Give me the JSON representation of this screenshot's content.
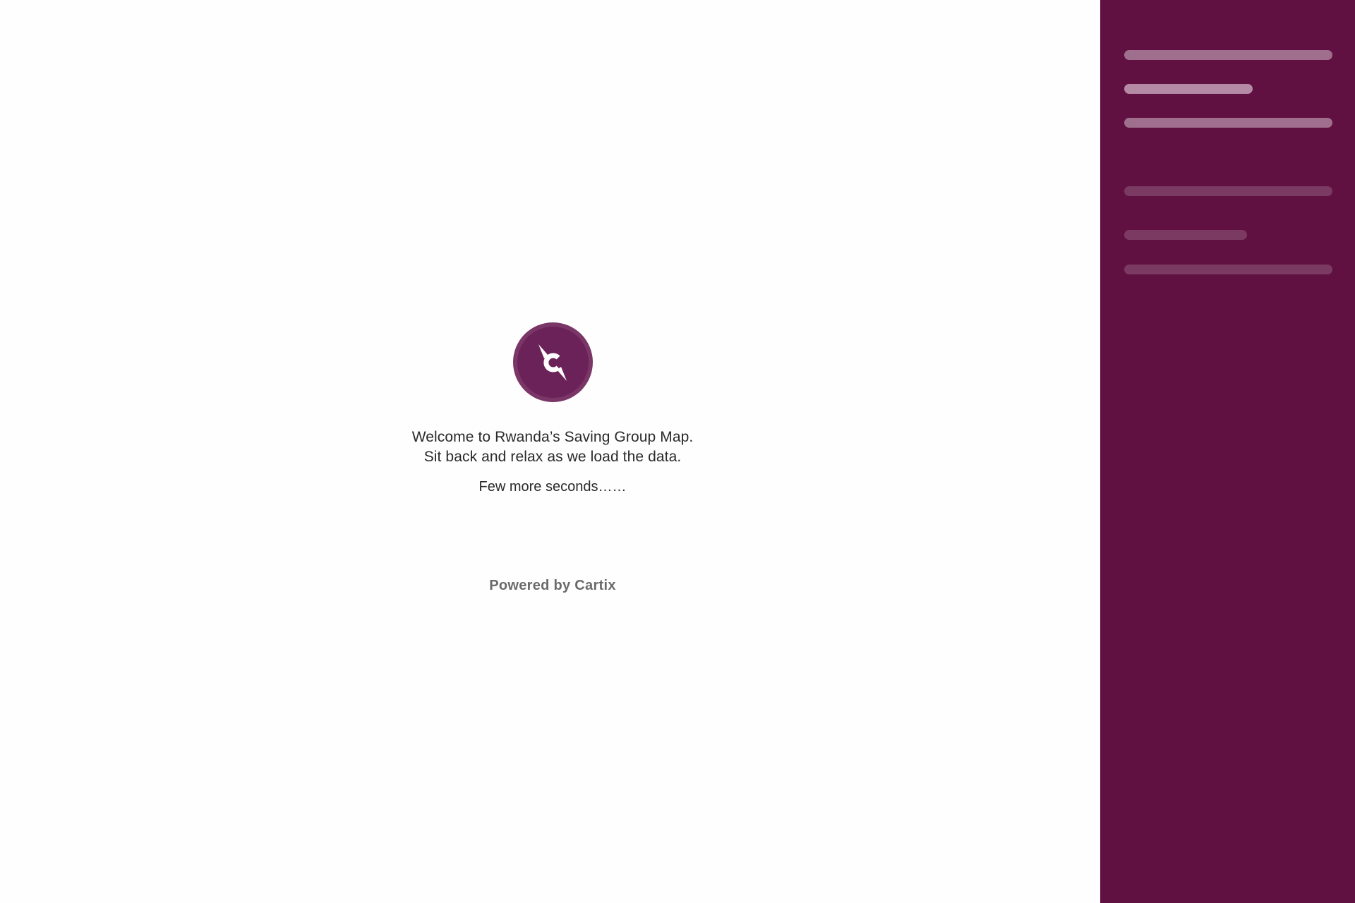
{
  "loader": {
    "logo_icon": "cartix-compass-icon",
    "welcome_line1": "Welcome to Rwanda’s Saving Group Map.",
    "welcome_line2": "Sit back and relax as we load the data.",
    "status": "Few more seconds……",
    "powered_by": "Powered by Cartix"
  },
  "colors": {
    "brand": "#601141",
    "logo_ring": "#7a3667",
    "logo_fill": "#6b2258",
    "text": "#2a2a2a",
    "muted": "#6a6a6a"
  }
}
